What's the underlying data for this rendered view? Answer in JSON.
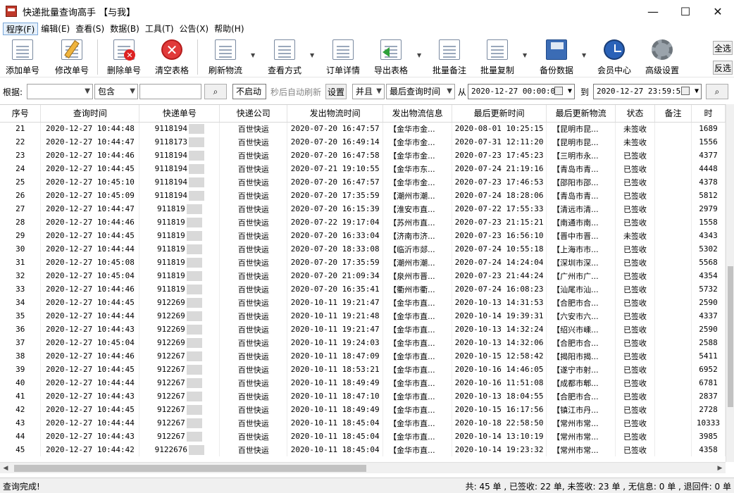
{
  "window": {
    "title": "快递批量查询高手 【与我】",
    "minimize": "—",
    "maximize": "☐",
    "close": "✕"
  },
  "menu": [
    "程序(F)",
    "编辑(E)",
    "查看(S)",
    "数据(B)",
    "工具(T)",
    "公告(X)",
    "帮助(H)"
  ],
  "toolbar": {
    "add": "添加单号",
    "edit": "修改单号",
    "delete": "删除单号",
    "clear": "清空表格",
    "refresh": "刷新物流",
    "view_mode": "查看方式",
    "order_detail": "订单详情",
    "export": "导出表格",
    "batch_note": "批量备注",
    "batch_copy": "批量复制",
    "backup": "备份数据",
    "member": "会员中心",
    "settings": "高级设置",
    "select_all": "全选",
    "invert": "反选"
  },
  "filter": {
    "basis_label": "根据:",
    "basis_value": "",
    "match_value": "包含",
    "keyword": "",
    "search_icon": "⌕",
    "auto_refresh_value": "不启动",
    "auto_refresh_label": "秒后自动刷新",
    "set_button": "设置",
    "logic_value": "并且",
    "time_field_value": "最后查询时间",
    "from_label": "从",
    "from_date": "2020-12-27 00:00:00",
    "to_label": "到",
    "to_date": "2020-12-27 23:59:59"
  },
  "table": {
    "headers": [
      "序号",
      "查询时间",
      "快递单号",
      "快递公司",
      "发出物流时间",
      "发出物流信息",
      "最后更新时间",
      "最后更新物流",
      "状态",
      "备注",
      "时"
    ],
    "rows": [
      [
        "21",
        "2020-12-27 10:44:48",
        "9118194",
        "百世快运",
        "2020-07-20 16:47:57",
        "【金华市金...",
        "2020-08-01 10:25:15",
        "【昆明市昆...",
        "未签收",
        "",
        "1689"
      ],
      [
        "22",
        "2020-12-27 10:44:47",
        "9118173",
        "百世快运",
        "2020-07-20 16:49:14",
        "【金华市金...",
        "2020-07-31 12:11:20",
        "【昆明市昆...",
        "未签收",
        "",
        "1556"
      ],
      [
        "23",
        "2020-12-27 10:44:46",
        "9118194",
        "百世快运",
        "2020-07-20 16:47:58",
        "【金华市金...",
        "2020-07-23 17:45:23",
        "【三明市永...",
        "已签收",
        "",
        "4377"
      ],
      [
        "24",
        "2020-12-27 10:44:45",
        "9118194",
        "百世快运",
        "2020-07-21 19:10:55",
        "【金华市东...",
        "2020-07-24 21:19:16",
        "【青岛市青...",
        "已签收",
        "",
        "4448"
      ],
      [
        "25",
        "2020-12-27 10:45:10",
        "9118194",
        "百世快运",
        "2020-07-20 16:47:57",
        "【金华市金...",
        "2020-07-23 17:46:53",
        "【邵阳市邵...",
        "已签收",
        "",
        "4378"
      ],
      [
        "26",
        "2020-12-27 10:45:09",
        "9118194",
        "百世快运",
        "2020-07-20 17:35:59",
        "【潮州市潮...",
        "2020-07-24 18:28:06",
        "【青岛市青...",
        "已签收",
        "",
        "5812"
      ],
      [
        "27",
        "2020-12-27 10:44:47",
        "911819",
        "百世快运",
        "2020-07-20 16:15:39",
        "【淮安市直...",
        "2020-07-22 17:55:33",
        "【清远市清...",
        "已签收",
        "",
        "2979"
      ],
      [
        "28",
        "2020-12-27 10:44:46",
        "911819",
        "百世快运",
        "2020-07-22 19:17:04",
        "【苏州市直...",
        "2020-07-23 21:15:21",
        "【南通市南...",
        "已签收",
        "",
        "1558"
      ],
      [
        "29",
        "2020-12-27 10:44:45",
        "911819",
        "百世快运",
        "2020-07-20 16:33:04",
        "【济南市济...",
        "2020-07-23 16:56:10",
        "【晋中市晋...",
        "未签收",
        "",
        "4343"
      ],
      [
        "30",
        "2020-12-27 10:44:44",
        "911819",
        "百世快运",
        "2020-07-20 18:33:08",
        "【临沂市郯...",
        "2020-07-24 10:55:18",
        "【上海市市...",
        "已签收",
        "",
        "5302"
      ],
      [
        "31",
        "2020-12-27 10:45:08",
        "911819",
        "百世快运",
        "2020-07-20 17:35:59",
        "【潮州市潮...",
        "2020-07-24 14:24:04",
        "【深圳市深...",
        "已签收",
        "",
        "5568"
      ],
      [
        "32",
        "2020-12-27 10:45:04",
        "911819",
        "百世快运",
        "2020-07-20 21:09:34",
        "【泉州市晋...",
        "2020-07-23 21:44:24",
        "【广州市广...",
        "已签收",
        "",
        "4354"
      ],
      [
        "33",
        "2020-12-27 10:44:46",
        "911819",
        "百世快运",
        "2020-07-20 16:35:41",
        "【衢州市衢...",
        "2020-07-24 16:08:23",
        "【汕尾市汕...",
        "已签收",
        "",
        "5732"
      ],
      [
        "34",
        "2020-12-27 10:44:45",
        "912269",
        "百世快运",
        "2020-10-11 19:21:47",
        "【金华市直...",
        "2020-10-13 14:31:53",
        "【合肥市合...",
        "已签收",
        "",
        "2590"
      ],
      [
        "35",
        "2020-12-27 10:44:44",
        "912269",
        "百世快运",
        "2020-10-11 19:21:48",
        "【金华市直...",
        "2020-10-14 19:39:31",
        "【六安市六...",
        "已签收",
        "",
        "4337"
      ],
      [
        "36",
        "2020-12-27 10:44:43",
        "912269",
        "百世快运",
        "2020-10-11 19:21:47",
        "【金华市直...",
        "2020-10-13 14:32:24",
        "【绍兴市嵊...",
        "已签收",
        "",
        "2590"
      ],
      [
        "37",
        "2020-12-27 10:45:04",
        "912269",
        "百世快运",
        "2020-10-11 19:24:03",
        "【金华市直...",
        "2020-10-13 14:32:06",
        "【合肥市合...",
        "已签收",
        "",
        "2588"
      ],
      [
        "38",
        "2020-12-27 10:44:46",
        "912267",
        "百世快运",
        "2020-10-11 18:47:09",
        "【金华市直...",
        "2020-10-15 12:58:42",
        "【揭阳市揭...",
        "已签收",
        "",
        "5411"
      ],
      [
        "39",
        "2020-12-27 10:44:45",
        "912267",
        "百世快运",
        "2020-10-11 18:53:21",
        "【金华市直...",
        "2020-10-16 14:46:05",
        "【遂宁市射...",
        "已签收",
        "",
        "6952"
      ],
      [
        "40",
        "2020-12-27 10:44:44",
        "912267",
        "百世快运",
        "2020-10-11 18:49:49",
        "【金华市直...",
        "2020-10-16 11:51:08",
        "【成都市郫...",
        "已签收",
        "",
        "6781"
      ],
      [
        "41",
        "2020-12-27 10:44:43",
        "912267",
        "百世快运",
        "2020-10-11 18:47:10",
        "【金华市直...",
        "2020-10-13 18:04:55",
        "【合肥市合...",
        "已签收",
        "",
        "2837"
      ],
      [
        "42",
        "2020-12-27 10:44:45",
        "912267",
        "百世快运",
        "2020-10-11 18:49:49",
        "【金华市直...",
        "2020-10-15 16:17:56",
        "【镇江市丹...",
        "已签收",
        "",
        "2728"
      ],
      [
        "43",
        "2020-12-27 10:44:44",
        "912267",
        "百世快运",
        "2020-10-11 18:45:04",
        "【金华市直...",
        "2020-10-18 22:58:50",
        "【常州市常...",
        "已签收",
        "",
        "10333"
      ],
      [
        "44",
        "2020-12-27 10:44:43",
        "912267",
        "百世快运",
        "2020-10-11 18:45:04",
        "【金华市直...",
        "2020-10-14 13:10:19",
        "【常州市常...",
        "已签收",
        "",
        "3985"
      ],
      [
        "45",
        "2020-12-27 10:44:42",
        "9122676",
        "百世快运",
        "2020-10-11 18:45:04",
        "【金华市直...",
        "2020-10-14 19:23:32",
        "【常州市常...",
        "已签收",
        "",
        "4358"
      ]
    ]
  },
  "status": {
    "left": "查询完成!",
    "right": "共: 45 单 , 已签收: 22 单, 未签收: 23 单 , 无信息: 0 单 , 退回件: 0 单"
  }
}
